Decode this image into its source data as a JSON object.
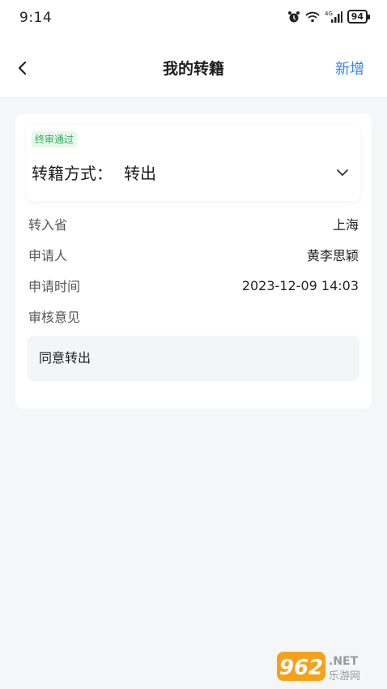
{
  "status": {
    "time": "9:14",
    "network": "4G",
    "battery": "94"
  },
  "nav": {
    "title": "我的转籍",
    "action": "新增"
  },
  "record": {
    "badge": "终审通过",
    "method_label": "转籍方式：",
    "method_value": "转出",
    "fields": [
      {
        "label": "转入省",
        "value": "上海"
      },
      {
        "label": "申请人",
        "value": "黄李思颖"
      },
      {
        "label": "申请时间",
        "value": "2023-12-09 14:03"
      },
      {
        "label": "审核意见",
        "value": ""
      }
    ],
    "opinion": "同意转出"
  },
  "watermark": {
    "number": "962",
    "suffix": ".NET",
    "caption": "乐游网"
  },
  "colors": {
    "accent": "#3a85f0",
    "badge_text": "#2fae55",
    "badge_bg": "#e7f7ec",
    "page_bg": "#f5f6f8"
  }
}
